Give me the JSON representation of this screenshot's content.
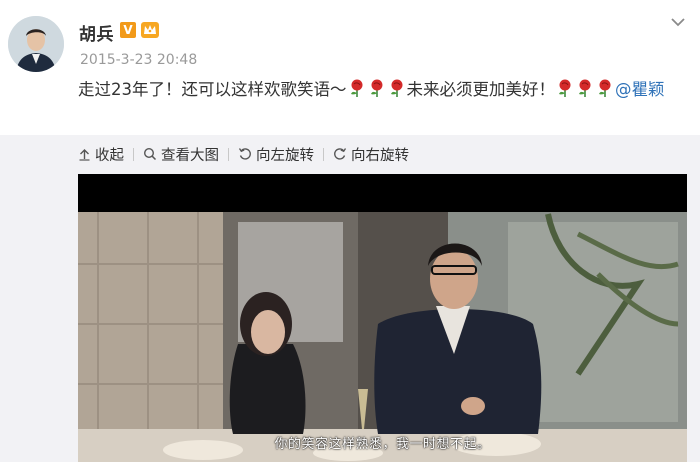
{
  "post": {
    "username": "胡兵",
    "vip_badge": "V",
    "timestamp": "2015-3-23 20:48",
    "text_part1": "走过23年了！还可以这样欢歌笑语～",
    "text_part2": "未来必须更加美好！",
    "mention": "@瞿颖"
  },
  "toolbar": {
    "collapse_label": "收起",
    "view_large_label": "查看大图",
    "rotate_left_label": "向左旋转",
    "rotate_right_label": "向右旋转"
  },
  "photo": {
    "subtitle": "你的笑容这样熟悉，我一时想不起。"
  },
  "icons": {
    "more": "chevron-down-icon",
    "emoji": "rose-icon",
    "collapse": "arrow-up-icon",
    "zoom": "search-icon",
    "rotate_left": "rotate-left-icon",
    "rotate_right": "rotate-right-icon"
  },
  "colors": {
    "mention": "#2f72b8",
    "vip_badge": "#f29a19",
    "timestamp": "#9a9a9a",
    "media_bg": "#f2f2f5"
  }
}
